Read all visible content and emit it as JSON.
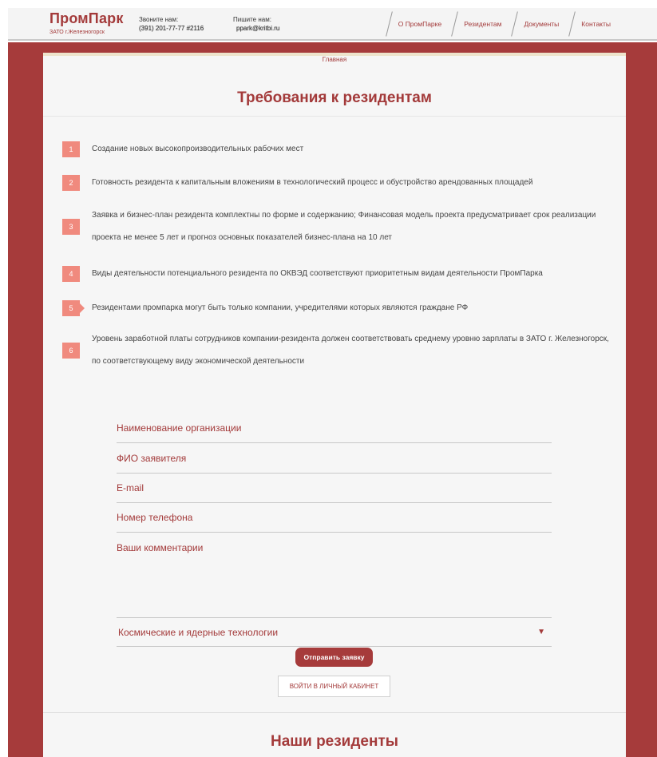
{
  "header": {
    "logo_title": "ПромПарк",
    "logo_sub": "ЗАТО г.Железногорск",
    "phone_label": "Звоните нам:",
    "phone_value": "(391) 201-77-77 #2116",
    "email_label": "Пишите нам:",
    "email_value": "ppark@kritbi.ru",
    "nav": [
      "О ПромПарке",
      "Резидентам",
      "Документы",
      "Контакты"
    ]
  },
  "breadcrumb": "Главная",
  "page_title": "Требования к резидентам",
  "requirements": [
    {
      "num": "1",
      "text": "Создание новых высокопроизводительных рабочих мест"
    },
    {
      "num": "2",
      "text": "Готовность резидента к капитальным вложениям в технологический процесс и обустройство арендованных площадей"
    },
    {
      "num": "3",
      "text": "Заявка и бизнес-план резидента комплектны по форме и содержанию; Финансовая модель проекта предусматривает срок реализации проекта не менее 5 лет и прогноз основных показателей бизнес-плана на 10 лет"
    },
    {
      "num": "4",
      "text": "Виды деятельности потенциального резидента по ОКВЭД соответствуют приоритетным видам деятельности ПромПарка"
    },
    {
      "num": "5",
      "text": "Резидентами промпарка могут быть только компании, учредителями которых являются граждане РФ"
    },
    {
      "num": "6",
      "text": "Уровень заработной платы сотрудников компании-резидента должен соответствовать среднему уровню зарплаты в ЗАТО г. Железногорск, по соответствующему виду экономической деятельности"
    }
  ],
  "form": {
    "org_placeholder": "Наименование организации",
    "name_placeholder": "ФИО заявителя",
    "email_placeholder": "E-mail",
    "phone_placeholder": "Номер телефона",
    "comment_placeholder": "Ваши комментарии",
    "select_value": "Космические и ядерные технологии",
    "submit_label": "Отправить заявку",
    "cabinet_label": "ВОЙТИ В ЛИЧНЫЙ КАБИНЕТ"
  },
  "residents_title": "Наши резиденты"
}
